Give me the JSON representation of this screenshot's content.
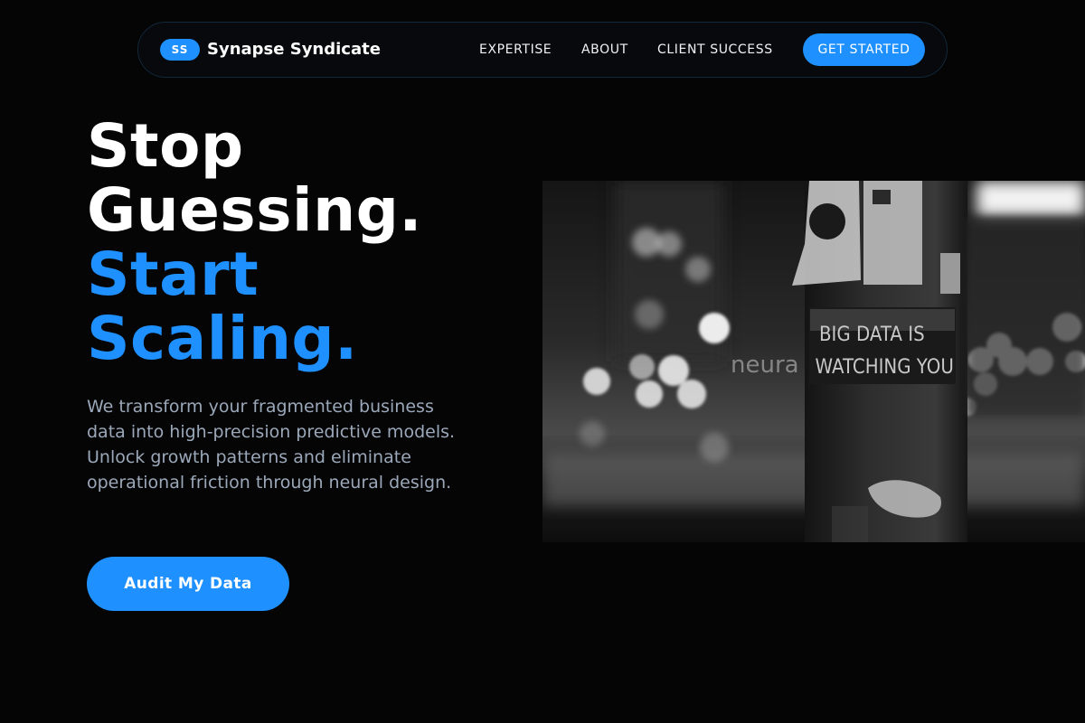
{
  "nav": {
    "logo_badge": "SS",
    "brand": "Synapse Syndicate",
    "links": [
      {
        "label": "EXPERTISE"
      },
      {
        "label": "ABOUT"
      },
      {
        "label": "CLIENT SUCCESS"
      }
    ],
    "cta": "GET STARTED"
  },
  "hero": {
    "line1": "Stop",
    "line2": "Guessing.",
    "line3": "Start",
    "line4": "Scaling.",
    "subtitle": "We transform your fragmented business data into high-precision predictive models. Unlock growth patterns and eliminate operational friction through neural design.",
    "cta": "Audit My Data"
  },
  "image": {
    "sign_text": "BIG DATA IS WATCHING YOU",
    "overlay_text": "neura"
  },
  "colors": {
    "accent": "#1e90ff",
    "background": "#050506",
    "muted_text": "#9ba8b9"
  }
}
